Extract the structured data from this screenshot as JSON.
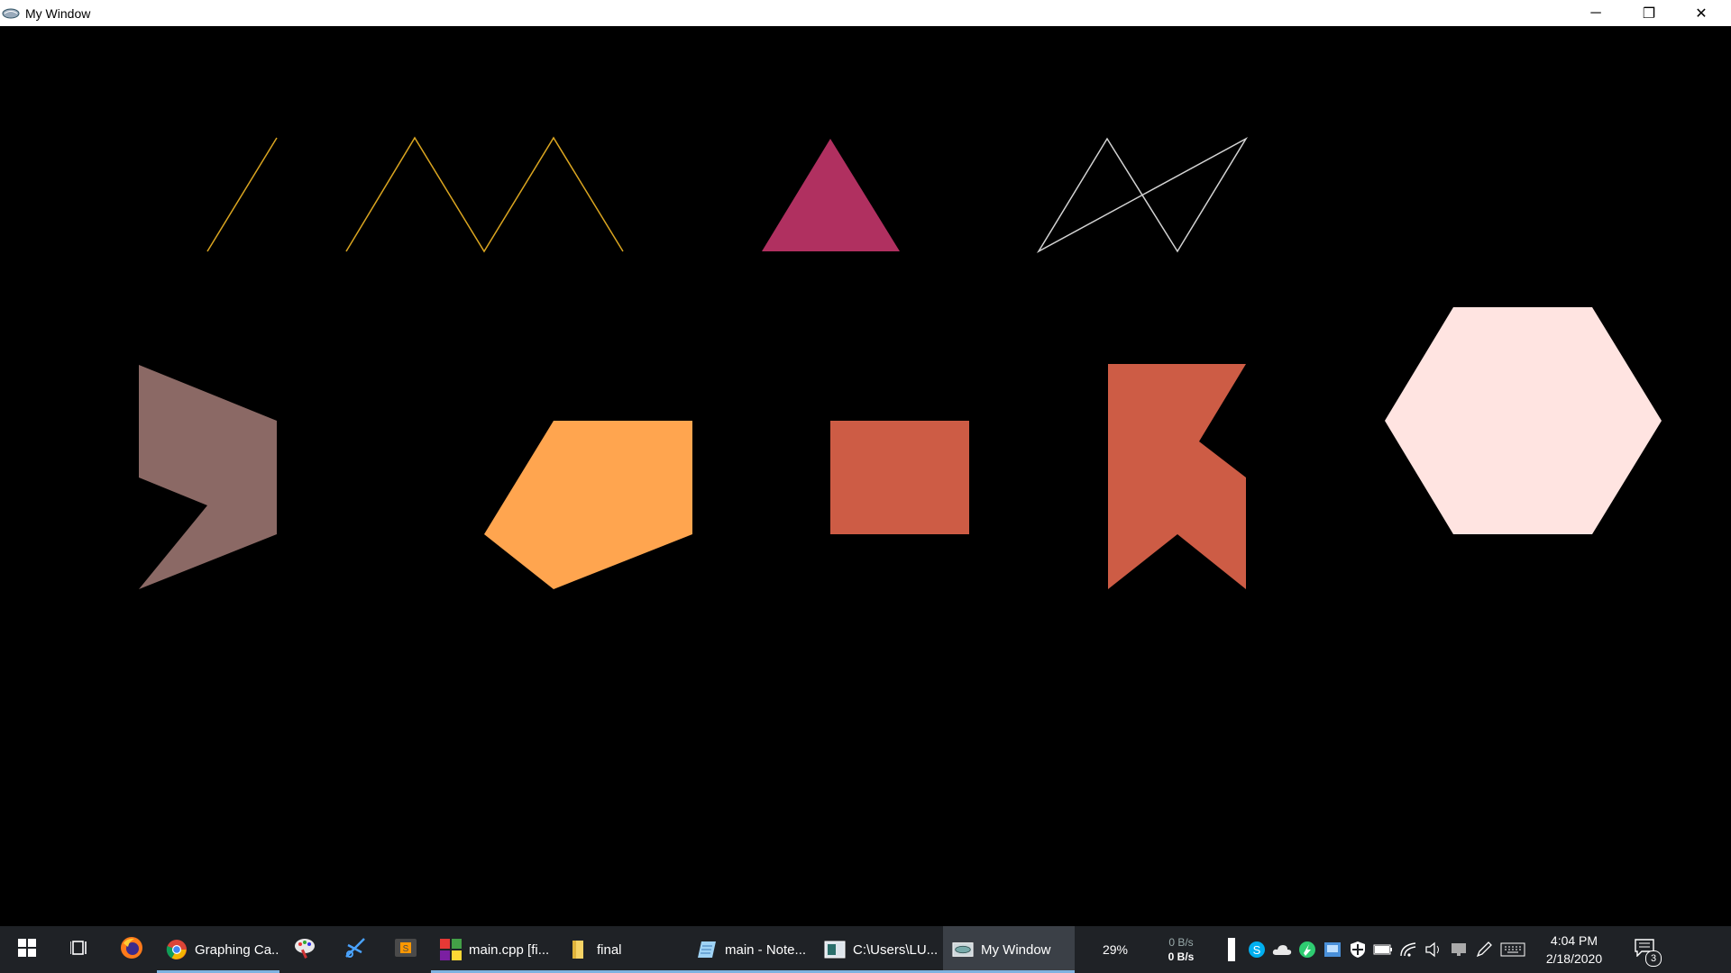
{
  "window": {
    "title": "My Window",
    "minimize_label": "─",
    "restore_label": "❐",
    "close_label": "✕"
  },
  "canvas": {
    "background": "#000000",
    "shapes": [
      {
        "name": "single-line",
        "kind": "polyline",
        "stroke": "#DAA520"
      },
      {
        "name": "zigzag-line",
        "kind": "polyline",
        "stroke": "#DAA520"
      },
      {
        "name": "triangle",
        "kind": "polygon",
        "fill": "#B03060"
      },
      {
        "name": "crossed-quadrilateral",
        "kind": "polygon-outline",
        "stroke": "#D3D3D3"
      },
      {
        "name": "arrow-chevron",
        "kind": "polygon",
        "fill": "#8B6965"
      },
      {
        "name": "pentagon",
        "kind": "polygon",
        "fill": "#FFA54F"
      },
      {
        "name": "square",
        "kind": "polygon",
        "fill": "#CD5C45"
      },
      {
        "name": "flag-shape",
        "kind": "polygon",
        "fill": "#CD5C45"
      },
      {
        "name": "hexagon",
        "kind": "polygon",
        "fill": "#FFE4E1"
      }
    ]
  },
  "taskbar": {
    "start_icon": "windows-logo-icon",
    "task_view_icon": "task-view-icon",
    "tasks": [
      {
        "icon": "firefox-icon",
        "label": "",
        "running": false
      },
      {
        "icon": "chrome-icon",
        "label": "Graphing Ca...",
        "running": true
      },
      {
        "icon": "paint-icon",
        "label": "",
        "running": false
      },
      {
        "icon": "snip-icon",
        "label": "",
        "running": false
      },
      {
        "icon": "sublime-icon",
        "label": "",
        "running": false
      },
      {
        "icon": "codeblocks-icon",
        "label": "main.cpp [fi...",
        "running": true
      },
      {
        "icon": "folder-icon",
        "label": "final",
        "running": true
      },
      {
        "icon": "notepad-icon",
        "label": "main - Note...",
        "running": true
      },
      {
        "icon": "console-icon",
        "label": "C:\\Users\\LU...",
        "running": true
      },
      {
        "icon": "glut-window-icon",
        "label": "My Window",
        "running": true,
        "active": true
      }
    ],
    "battery_percent_label": "29%",
    "net_up": "0 B/s",
    "net_down": "0 B/s",
    "tray_icons": [
      "battery-bar-icon",
      "skype-icon",
      "onedrive-icon",
      "green-app-icon",
      "network-monitor-icon",
      "defender-icon",
      "battery-icon",
      "wifi-icon",
      "volume-icon",
      "display-icon",
      "pen-icon",
      "keyboard-icon"
    ],
    "clock_time": "4:04 PM",
    "clock_date": "2/18/2020",
    "notification_count": "3"
  }
}
